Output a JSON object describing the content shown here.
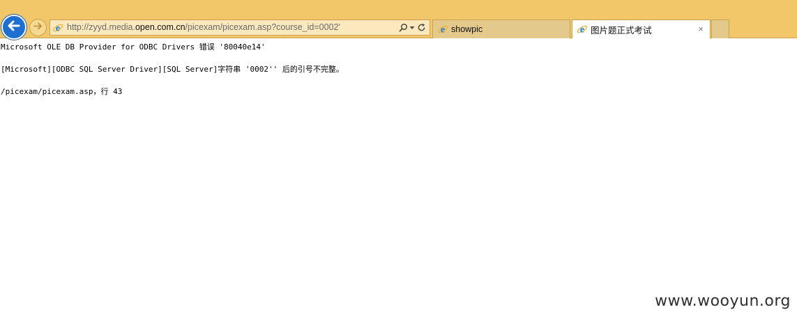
{
  "browser": {
    "back_icon": "back-arrow-icon",
    "forward_icon": "forward-arrow-icon",
    "address": {
      "url_prefix": "http://zyyd.media.",
      "url_domain": "open.com.cn",
      "url_suffix": "/picexam/picexam.asp?course_id=0002'",
      "icons": [
        "ie-icon",
        "search-icon",
        "chevron-down-icon",
        "refresh-icon"
      ]
    },
    "tabs": [
      {
        "label": "showpic",
        "active": false,
        "icon": "ie-icon"
      },
      {
        "label": "图片题正式考试",
        "active": true,
        "icon": "ie-icon",
        "close_label": "×"
      }
    ],
    "colors": {
      "chrome": "#f1c76a",
      "accent": "#1e6fd0",
      "address_bg": "#fbe8bd"
    }
  },
  "page": {
    "error_lines": [
      "Microsoft OLE DB Provider for ODBC Drivers 错误 '80040e14'",
      "[Microsoft][ODBC SQL Server Driver][SQL Server]字符串 '0002'' 后的引号不完整。",
      "/picexam/picexam.asp，行 43"
    ]
  },
  "watermark": {
    "text": "www.wooyun.org"
  }
}
